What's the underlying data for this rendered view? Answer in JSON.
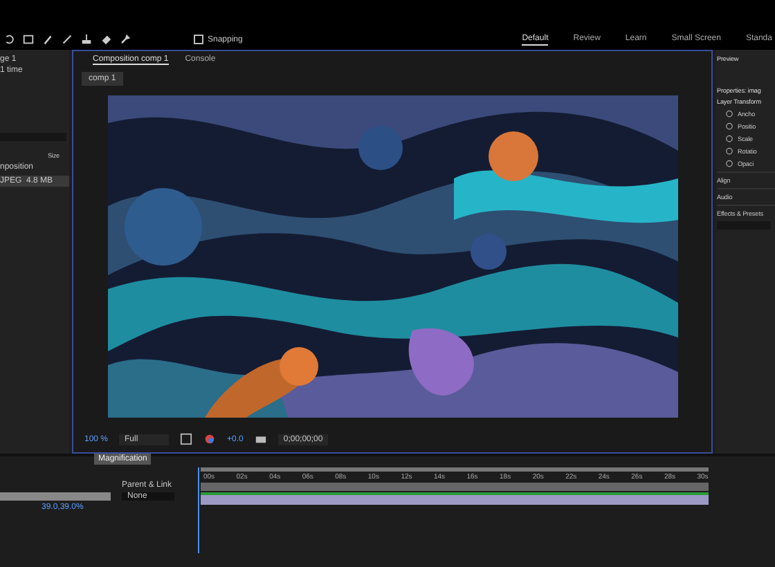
{
  "toolbar": {
    "snapping": {
      "label": "Snapping",
      "checked": false
    }
  },
  "workspaces": [
    {
      "label": "Default",
      "selected": true
    },
    {
      "label": "Review",
      "selected": false
    },
    {
      "label": "Learn",
      "selected": false
    },
    {
      "label": "Small Screen",
      "selected": false
    },
    {
      "label": "Standa",
      "selected": false
    }
  ],
  "project_panel": {
    "title": "ge 1",
    "subtitle": "1 time",
    "column": "Size",
    "items": [
      {
        "name": "nposition"
      },
      {
        "name": "JPEG",
        "size": "4.8 MB"
      }
    ]
  },
  "composition_panel": {
    "tabs": [
      {
        "label": "Composition comp 1",
        "selected": true
      },
      {
        "label": "Console",
        "selected": false
      }
    ],
    "breadcrumb": "comp 1",
    "footer": {
      "magnification": "100 %",
      "resolution": "Full",
      "exposure": "+0.0",
      "timecode": "0;00;00;00"
    },
    "tooltip": "Magnification"
  },
  "right_panel": {
    "preview": "Preview",
    "properties": "Properties: imag",
    "transform": "Layer Transform",
    "properties_list": [
      "Ancho",
      "Positio",
      "Scale",
      "Rotatio",
      "Opaci"
    ],
    "sections": [
      "Align",
      "Audio",
      "Effects & Presets"
    ]
  },
  "timeline": {
    "parent_header": "Parent & Link",
    "parent_value": "None",
    "scale_value": "39.0,39.0%",
    "ticks": [
      "00s",
      "02s",
      "04s",
      "06s",
      "08s",
      "10s",
      "12s",
      "14s",
      "16s",
      "18s",
      "20s",
      "22s",
      "24s",
      "26s",
      "28s",
      "30s"
    ]
  }
}
